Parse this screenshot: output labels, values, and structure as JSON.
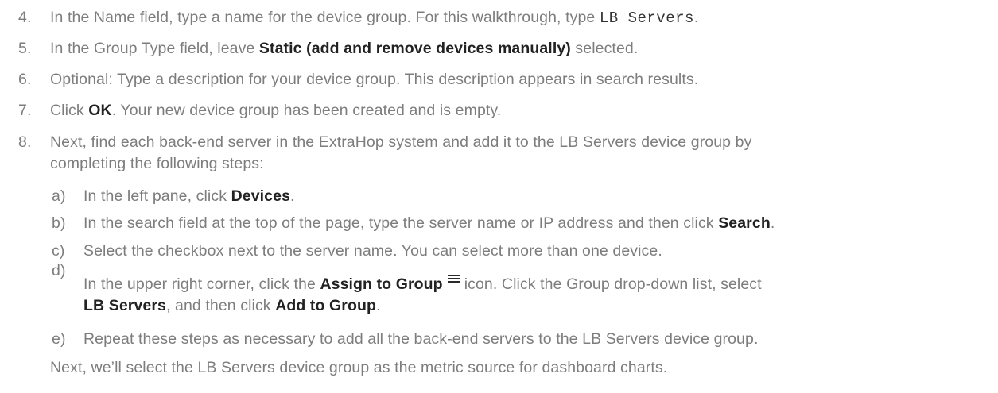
{
  "steps": [
    {
      "num": "4.",
      "parts": [
        {
          "t": "In the Name field, type a name for the device group. For this walkthrough, type "
        },
        {
          "code": "LB Servers"
        },
        {
          "t": "."
        }
      ]
    },
    {
      "num": "5.",
      "parts": [
        {
          "t": "In the Group Type field, leave "
        },
        {
          "b": "Static (add and remove devices manually)"
        },
        {
          "t": " selected."
        }
      ]
    },
    {
      "num": "6.",
      "parts": [
        {
          "t": "Optional: Type a description for your device group. This description appears in search results."
        }
      ]
    },
    {
      "num": "7.",
      "parts": [
        {
          "t": "Click "
        },
        {
          "b": "OK"
        },
        {
          "t": ". Your new device group has been created and is empty."
        }
      ]
    },
    {
      "num": "8.",
      "line1": "Next, find each back-end server in the ExtraHop system and add it to the LB Servers device group by",
      "line2": "completing the following steps:"
    }
  ],
  "substeps": [
    {
      "label": "a)",
      "parts": [
        {
          "t": "In the left pane, click "
        },
        {
          "b": "Devices"
        },
        {
          "t": "."
        }
      ]
    },
    {
      "label": "b)",
      "parts": [
        {
          "t": "In the search field at the top of the page, type the server name or IP address and then click "
        },
        {
          "b": "Search"
        },
        {
          "t": "."
        }
      ]
    },
    {
      "label": "c)",
      "parts": [
        {
          "t": "Select the checkbox next to the server name. You can select more than one device."
        }
      ]
    },
    {
      "label": "d)",
      "line1": [
        {
          "t": "In the upper right corner, click the "
        },
        {
          "b": "Assign to Group"
        },
        {
          "icon": "assign-to-group-icon"
        },
        {
          "t": "icon. Click the Group drop-down list, select"
        }
      ],
      "line2": [
        {
          "b": "LB Servers"
        },
        {
          "t": ", and then click "
        },
        {
          "b": "Add to Group"
        },
        {
          "t": "."
        }
      ]
    },
    {
      "label": "e)",
      "parts": [
        {
          "t": "Repeat these steps as necessary to add all the back-end servers to the LB Servers device group."
        }
      ]
    }
  ],
  "closing": "Next, we’ll select the LB Servers device group as the metric source for dashboard charts.",
  "colors": {
    "body_text": "#7d7d7d",
    "emphasis": "#222222"
  }
}
